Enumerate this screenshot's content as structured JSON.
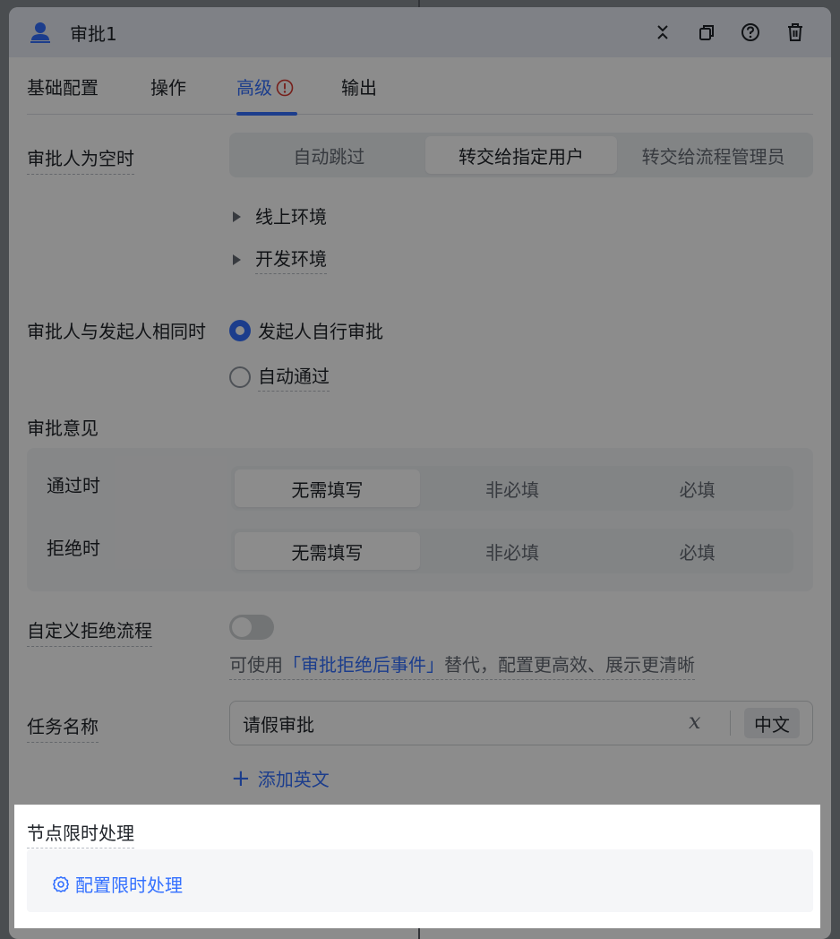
{
  "node": {
    "title": "审批1",
    "actions": [
      "collapse-icon",
      "copy-icon",
      "help-icon",
      "delete-icon"
    ]
  },
  "tabs": [
    {
      "label": "基础配置",
      "active": false
    },
    {
      "label": "操作",
      "active": false
    },
    {
      "label": "高级",
      "active": true,
      "warning": true
    },
    {
      "label": "输出",
      "active": false
    }
  ],
  "empty_approver": {
    "label": "审批人为空时",
    "options": [
      "自动跳过",
      "转交给指定用户",
      "转交给流程管理员"
    ],
    "selected": "转交给指定用户",
    "environments": [
      "线上环境",
      "开发环境"
    ]
  },
  "same_initiator": {
    "label": "审批人与发起人相同时",
    "options": [
      {
        "label": "发起人自行审批",
        "checked": true
      },
      {
        "label": "自动通过",
        "checked": false
      }
    ]
  },
  "opinion": {
    "label": "审批意见",
    "rows": [
      {
        "label": "通过时",
        "options": [
          "无需填写",
          "非必填",
          "必填"
        ],
        "selected": "无需填写"
      },
      {
        "label": "拒绝时",
        "options": [
          "无需填写",
          "非必填",
          "必填"
        ],
        "selected": "无需填写"
      }
    ]
  },
  "custom_reject": {
    "label": "自定义拒绝流程",
    "enabled": false,
    "hint_prefix": "可使用",
    "hint_link": "「审批拒绝后事件」",
    "hint_suffix": "替代，配置更高效、展示更清晰"
  },
  "task_name": {
    "label": "任务名称",
    "value": "请假审批",
    "fx_symbol": "𝑥",
    "lang": "中文",
    "add_english": "添加英文",
    "add_symbol": "+"
  },
  "time_limit": {
    "label": "节点限时处理",
    "button": "配置限时处理"
  },
  "colors": {
    "accent": "#3370ff",
    "warning": "#d83931"
  }
}
